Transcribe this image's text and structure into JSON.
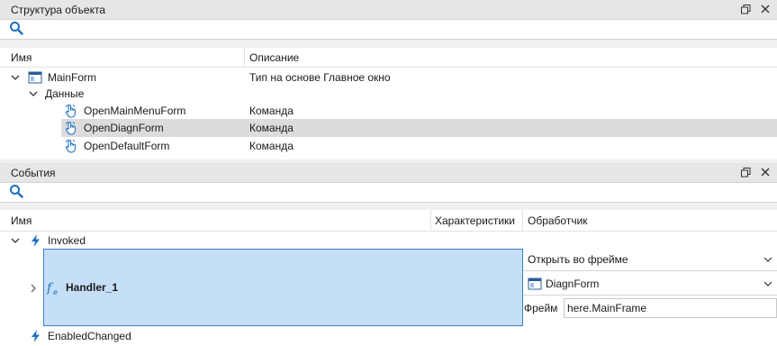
{
  "structure_panel": {
    "title": "Структура объекта",
    "columns": {
      "name": "Имя",
      "description": "Описание"
    },
    "rows": [
      {
        "name": "MainForm",
        "description": "Тип на основе Главное окно"
      },
      {
        "name": "Данные",
        "description": ""
      },
      {
        "name": "OpenMainMenuForm",
        "description": "Команда"
      },
      {
        "name": "OpenDiagnForm",
        "description": "Команда"
      },
      {
        "name": "OpenDefaultForm",
        "description": "Команда"
      }
    ]
  },
  "events_panel": {
    "title": "События",
    "columns": {
      "name": "Имя",
      "characteristics": "Характеристики",
      "handler": "Обработчик"
    },
    "event_invoked": "Invoked",
    "handler_name": "Handler_1",
    "handler_action": "Открыть во фрейме",
    "handler_form": "DiagnForm",
    "frame_label": "Фрейм",
    "frame_value": "here.MainFrame",
    "event_enabled_changed": "EnabledChanged"
  },
  "colors": {
    "accent": "#3d7fc9",
    "selection": "#c5dff7",
    "icon_blue": "#1e6fc0"
  }
}
